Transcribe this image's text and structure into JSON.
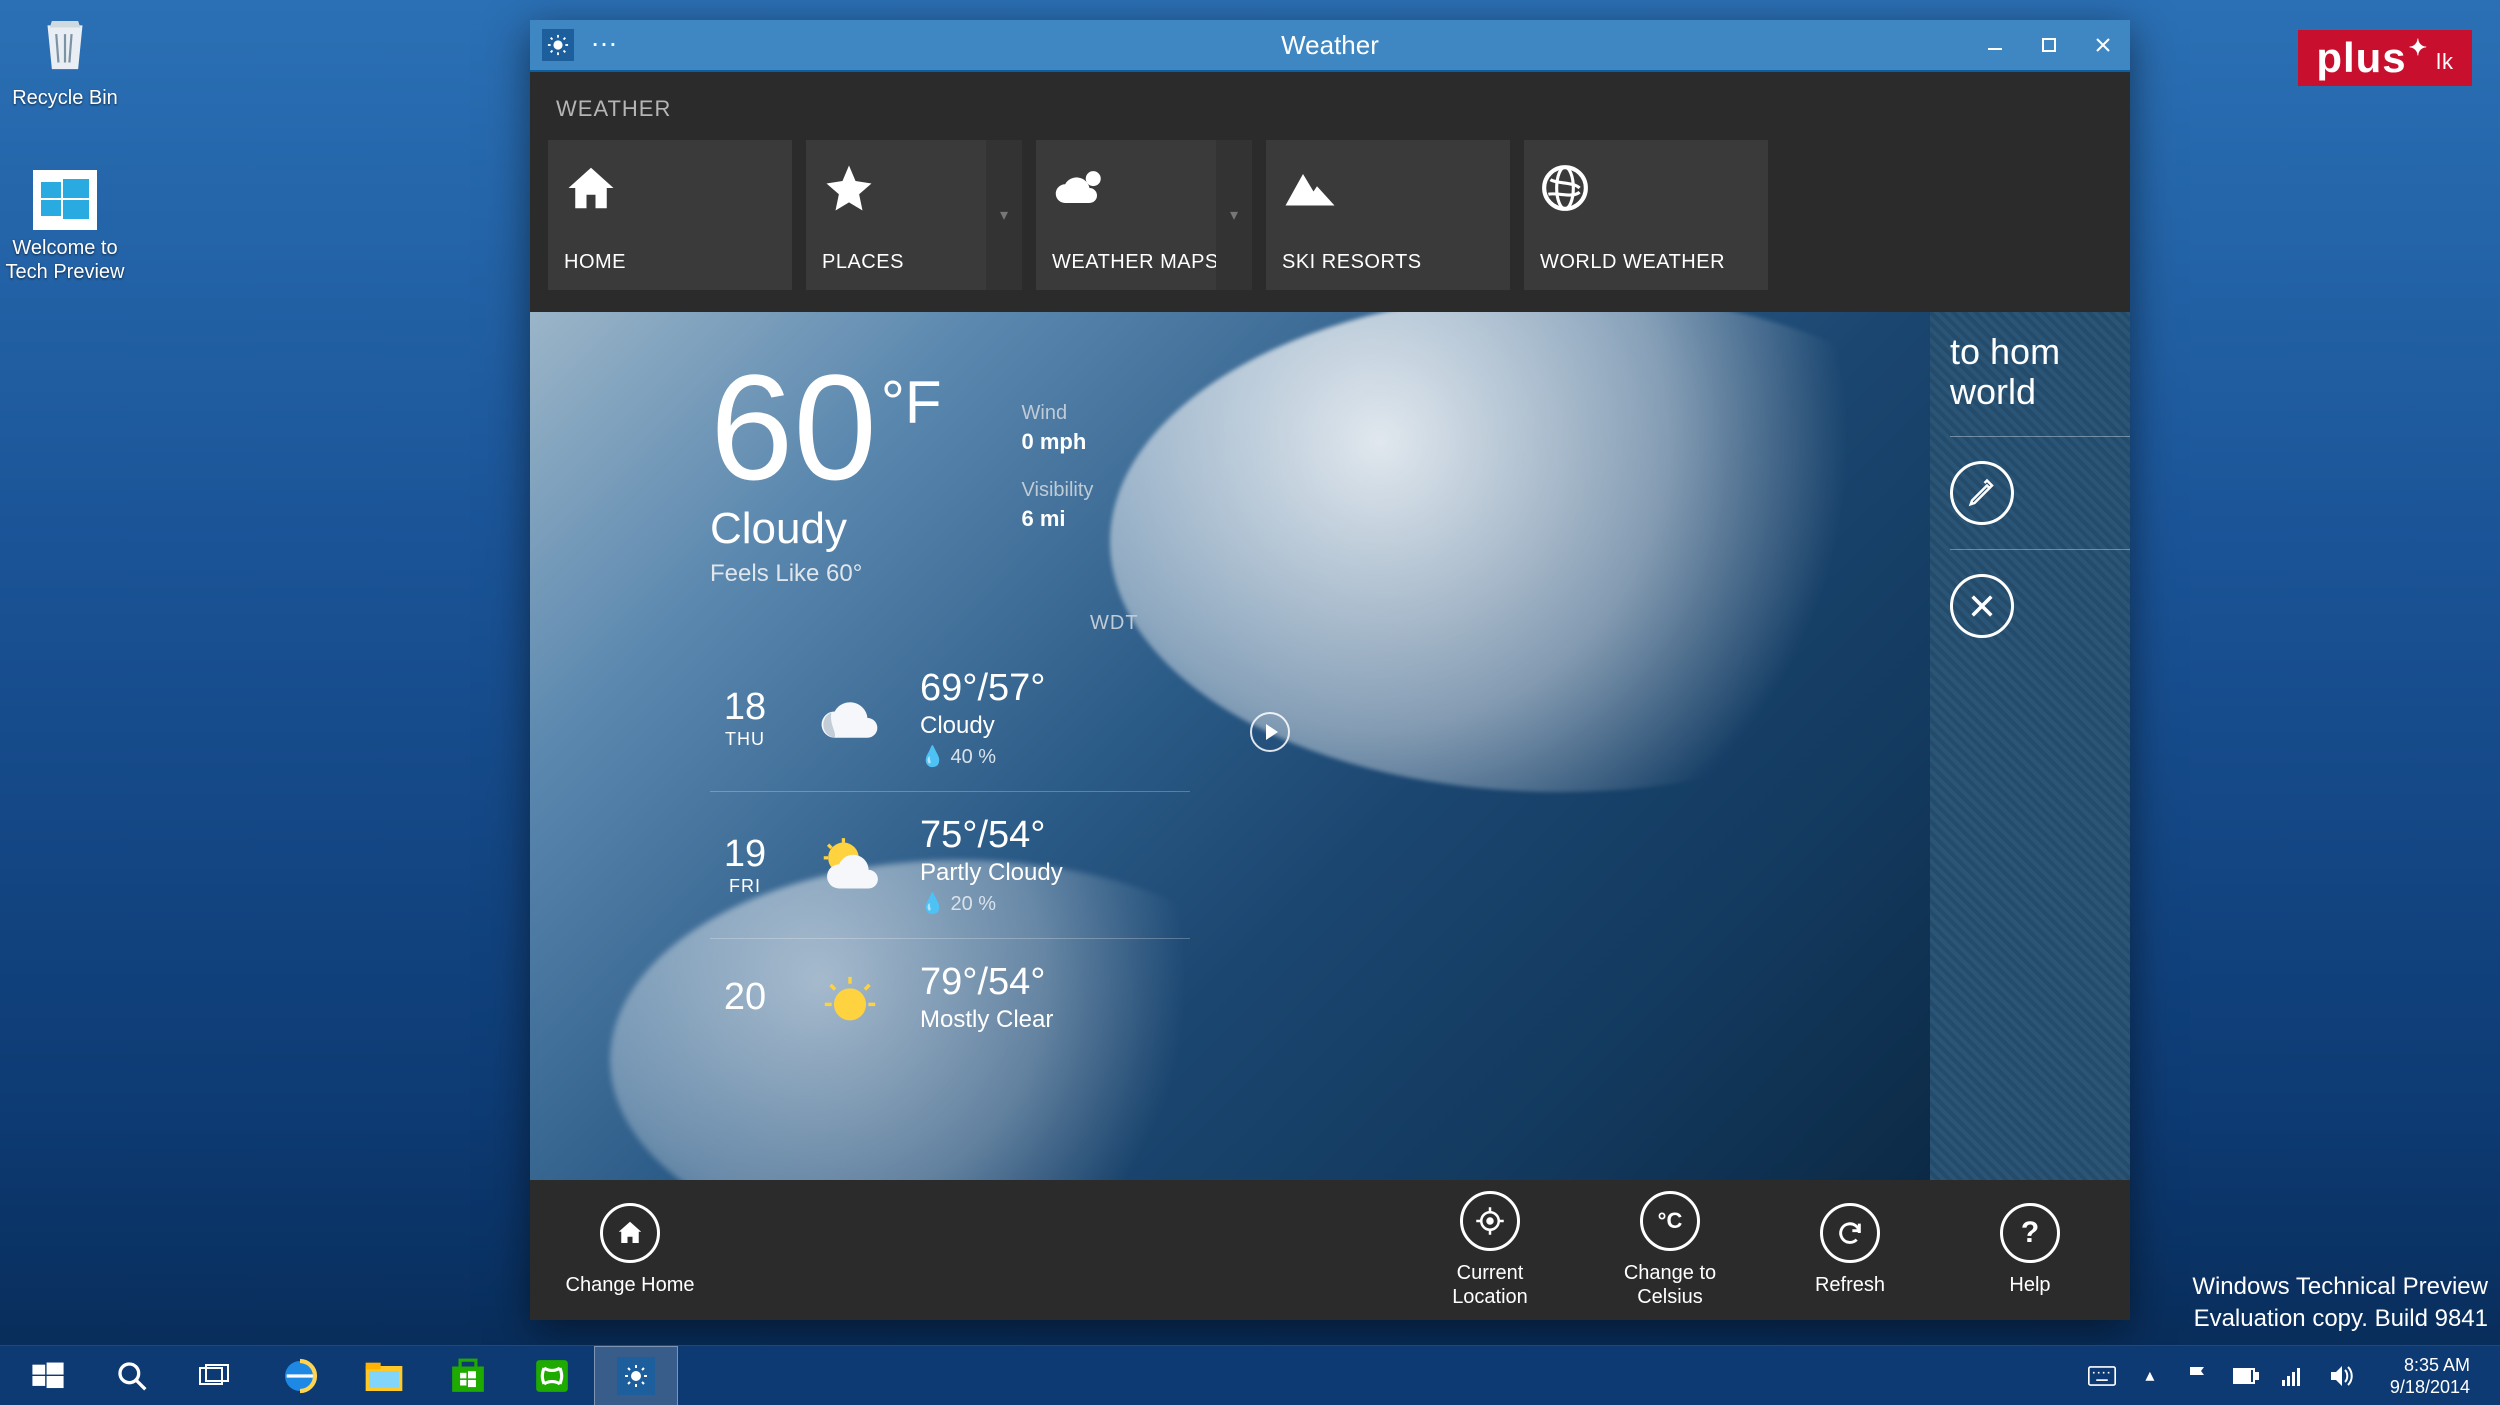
{
  "desktop": {
    "icons": {
      "recycle_bin": "Recycle Bin",
      "tech_preview": "Welcome to\nTech Preview"
    },
    "watermark_line1": "Windows Technical Preview",
    "watermark_line2": "Evaluation copy. Build 9841",
    "badge_main": "plus",
    "badge_sub": "lk"
  },
  "taskbar": {
    "clock_time": "8:35 AM",
    "clock_date": "9/18/2014"
  },
  "window": {
    "title": "Weather",
    "nav_heading": "WEATHER",
    "tiles": {
      "home": "HOME",
      "places": "PLACES",
      "weather_maps": "WEATHER MAPS",
      "ski_resorts": "SKI RESORTS",
      "world_weather": "WORLD WEATHER"
    }
  },
  "current": {
    "temp": "60",
    "unit": "°F",
    "condition": "Cloudy",
    "feels_like": "Feels Like 60°",
    "wind_label": "Wind",
    "wind_value": "0 mph",
    "visibility_label": "Visibility",
    "visibility_value": "6 mi",
    "provider": "WDT"
  },
  "forecast": [
    {
      "day_num": "18",
      "day_name": "THU",
      "hi_lo": "69°/57°",
      "desc": "Cloudy",
      "precip": "40 %",
      "icon": "cloud"
    },
    {
      "day_num": "19",
      "day_name": "FRI",
      "hi_lo": "75°/54°",
      "desc": "Partly Cloudy",
      "precip": "20 %",
      "icon": "partly"
    },
    {
      "day_num": "20",
      "day_name": "",
      "hi_lo": "79°/54°",
      "desc": "Mostly Clear",
      "precip": "",
      "icon": "sun"
    }
  ],
  "side": {
    "title1": "to hom",
    "title2": "world",
    "edit_text": "",
    "close_text": ""
  },
  "appbar": {
    "change_home": "Change Home",
    "current_location": "Current\nLocation",
    "change_celsius": "Change to\nCelsius",
    "refresh": "Refresh",
    "help": "Help"
  }
}
